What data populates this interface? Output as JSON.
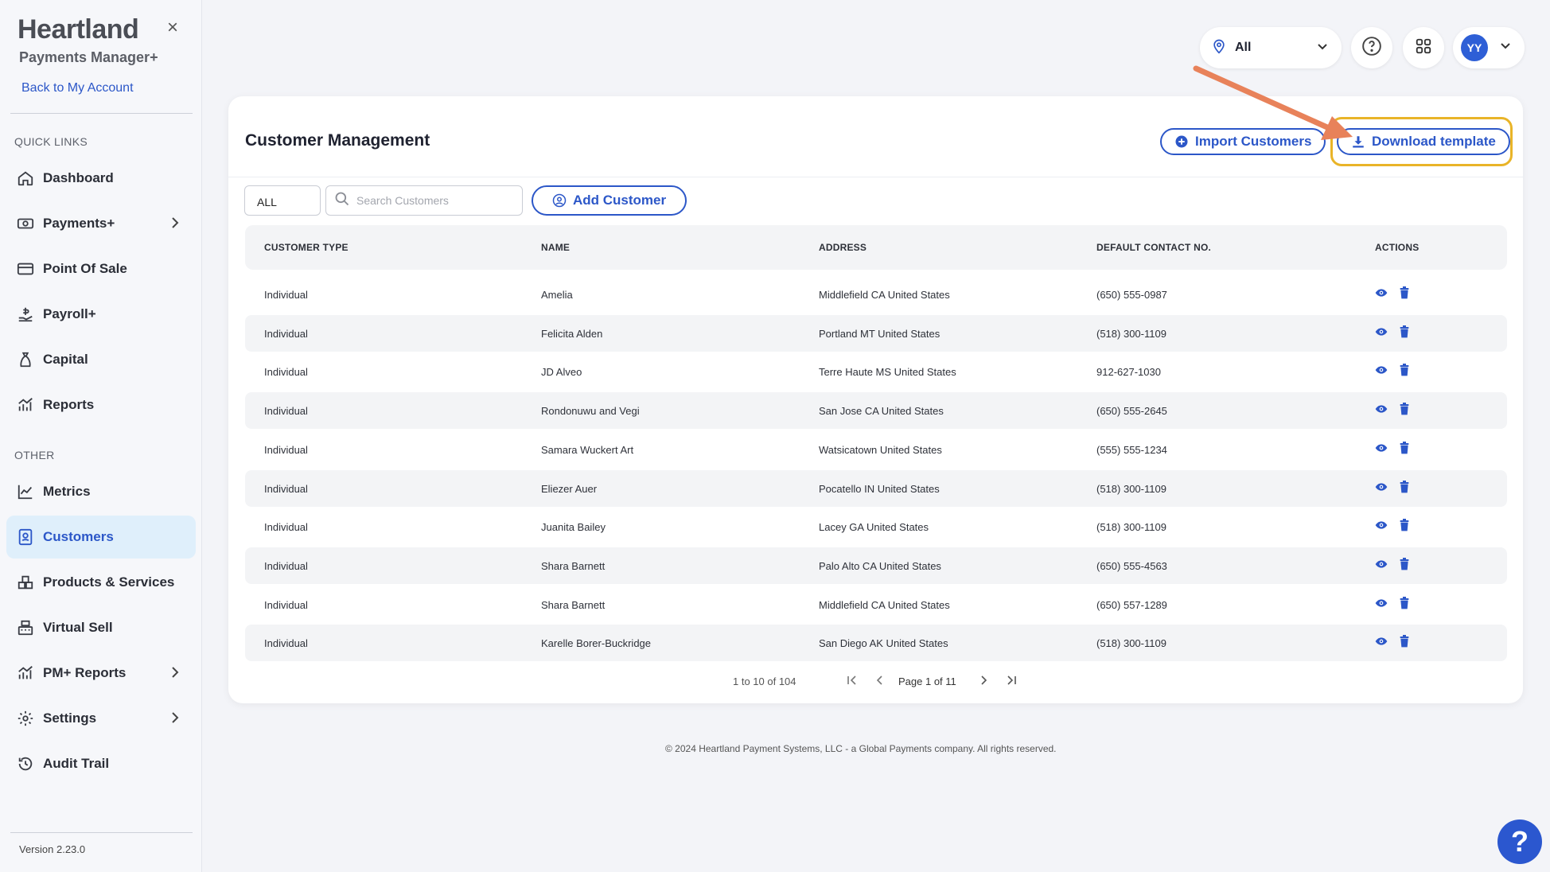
{
  "sidebar": {
    "brand": "Heartland",
    "brand_sub": "Payments Manager+",
    "back_link": "Back to My Account",
    "quick_links_title": "QUICK LINKS",
    "other_title": "OTHER",
    "quick_links": [
      {
        "label": "Dashboard",
        "icon": "home-icon"
      },
      {
        "label": "Payments+",
        "icon": "payments-icon"
      },
      {
        "label": "Point Of Sale",
        "icon": "card-icon"
      },
      {
        "label": "Payroll+",
        "icon": "payroll-icon"
      },
      {
        "label": "Capital",
        "icon": "moneybag-icon"
      },
      {
        "label": "Reports",
        "icon": "bar-chart-icon"
      }
    ],
    "other": [
      {
        "label": "Metrics",
        "icon": "line-chart-icon"
      },
      {
        "label": "Customers",
        "icon": "contacts-icon"
      },
      {
        "label": "Products & Services",
        "icon": "boxes-icon"
      },
      {
        "label": "Virtual Sell",
        "icon": "register-icon"
      },
      {
        "label": "PM+ Reports",
        "icon": "bar-chart-icon"
      },
      {
        "label": "Settings",
        "icon": "gear-icon"
      },
      {
        "label": "Audit Trail",
        "icon": "history-icon"
      }
    ],
    "version": "Version 2.23.0"
  },
  "topbar": {
    "location_value": "All",
    "avatar_initials": "YY"
  },
  "card": {
    "title": "Customer Management",
    "import_label": "Import Customers",
    "download_label": "Download template",
    "filter_value": "ALL",
    "search_placeholder": "Search Customers",
    "add_label": "Add Customer",
    "columns": [
      "CUSTOMER TYPE",
      "NAME",
      "ADDRESS",
      "DEFAULT CONTACT NO.",
      "ACTIONS"
    ],
    "rows": [
      {
        "type": "Individual",
        "name": "Amelia",
        "address": "Middlefield CA United States",
        "phone": "(650) 555-0987"
      },
      {
        "type": "Individual",
        "name": "Felicita Alden",
        "address": "Portland MT United States",
        "phone": "(518) 300-1109"
      },
      {
        "type": "Individual",
        "name": "JD Alveo",
        "address": "Terre Haute MS United States",
        "phone": "912-627-1030"
      },
      {
        "type": "Individual",
        "name": "Rondonuwu and Vegi",
        "address": "San Jose CA United States",
        "phone": "(650) 555-2645"
      },
      {
        "type": "Individual",
        "name": "Samara Wuckert Art",
        "address": "Watsicatown United States",
        "phone": "(555) 555-1234"
      },
      {
        "type": "Individual",
        "name": "Eliezer Auer",
        "address": "Pocatello IN United States",
        "phone": "(518) 300-1109"
      },
      {
        "type": "Individual",
        "name": "Juanita Bailey",
        "address": "Lacey GA United States",
        "phone": "(518) 300-1109"
      },
      {
        "type": "Individual",
        "name": "Shara Barnett",
        "address": "Palo Alto CA United States",
        "phone": "(650) 555-4563"
      },
      {
        "type": "Individual",
        "name": "Shara Barnett",
        "address": "Middlefield CA United States",
        "phone": "(650) 557-1289"
      },
      {
        "type": "Individual",
        "name": "Karelle Borer-Buckridge",
        "address": "San Diego AK United States",
        "phone": "(518) 300-1109"
      }
    ],
    "pager_count": "1 to 10 of 104",
    "pager_text": "Page 1 of 11"
  },
  "footer": "© 2024 Heartland Payment Systems, LLC - a Global Payments company. All rights reserved.",
  "help_fab": "?",
  "colors": {
    "accent": "#2c57c8",
    "highlight": "#e9b428",
    "arrow": "#e8825a"
  }
}
